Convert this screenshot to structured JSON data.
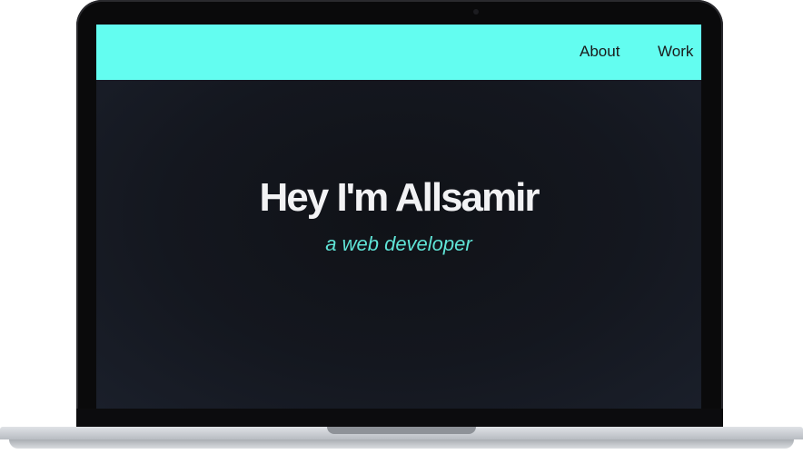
{
  "nav": {
    "about_label": "About",
    "work_label": "Work"
  },
  "hero": {
    "title": "Hey I'm Allsamir",
    "subtitle": "a web developer"
  },
  "colors": {
    "nav_background": "#63fdf0",
    "accent_text": "#5fe3d6",
    "screen_background": "#14171f",
    "title_text": "#f2f2f4"
  }
}
